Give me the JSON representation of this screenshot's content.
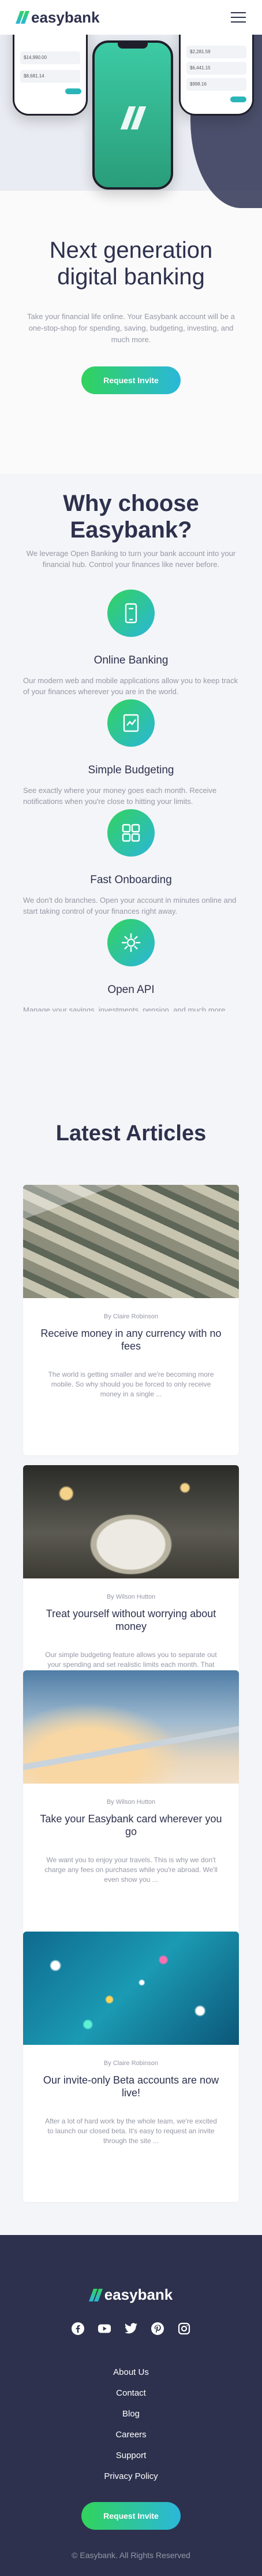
{
  "brand": {
    "name": "easybank"
  },
  "hero": {
    "title_line1": "Next generation",
    "title_line2": "digital banking",
    "text": "Take your financial life online. Your Easybank account will be a one-stop-shop for spending, saving, budgeting, investing, and much more.",
    "cta": "Request Invite",
    "mock_amounts_left": [
      "$14,990.00",
      "$8,681.14"
    ],
    "mock_amounts_right": [
      "$2,281.59",
      "$6,441.15",
      "$998.16"
    ]
  },
  "why": {
    "title_line1": "Why choose",
    "title_line2": "Easybank?",
    "intro": "We leverage Open Banking to turn your bank account into your financial hub. Control your finances like never before.",
    "features": [
      {
        "icon": "online-banking-icon",
        "title": "Online Banking",
        "text": "Our modern web and mobile applications allow you to keep track of your finances wherever you are in the world."
      },
      {
        "icon": "budgeting-icon",
        "title": "Simple Budgeting",
        "text": "See exactly where your money goes each month. Receive notifications when you're close to hitting your limits."
      },
      {
        "icon": "onboarding-icon",
        "title": "Fast Onboarding",
        "text": "We don't do branches. Open your account in minutes online and start taking control of your finances right away."
      },
      {
        "icon": "api-icon",
        "title": "Open API",
        "text": "Manage your savings, investments, pension, and much more from one account. Tracking your money has never been easier."
      }
    ]
  },
  "articles": {
    "title": "Latest Articles",
    "items": [
      {
        "author": "By Claire Robinson",
        "title": "Receive money in any currency with no fees",
        "excerpt": "The world is getting smaller and we're becoming more mobile. So why should you be forced to only receive money in a single ..."
      },
      {
        "author": "By Wilson Hutton",
        "title": "Treat yourself without worrying about money",
        "excerpt": "Our simple budgeting feature allows you to separate out your spending and set realistic limits each month. That means you ..."
      },
      {
        "author": "By Wilson Hutton",
        "title": "Take your Easybank card wherever you go",
        "excerpt": "We want you to enjoy your travels. This is why we don't charge any fees on purchases while you're abroad. We'll even show you ..."
      },
      {
        "author": "By Claire Robinson",
        "title": "Our invite-only Beta accounts are now live!",
        "excerpt": "After a lot of hard work by the whole team, we're excited to launch our closed beta. It's easy to request an invite through the site ..."
      }
    ]
  },
  "footer": {
    "links": [
      "About Us",
      "Contact",
      "Blog",
      "Careers",
      "Support",
      "Privacy Policy"
    ],
    "cta": "Request Invite",
    "copyright": "© Easybank. All Rights Reserved",
    "social": [
      "facebook-icon",
      "youtube-icon",
      "twitter-icon",
      "pinterest-icon",
      "instagram-icon"
    ]
  }
}
